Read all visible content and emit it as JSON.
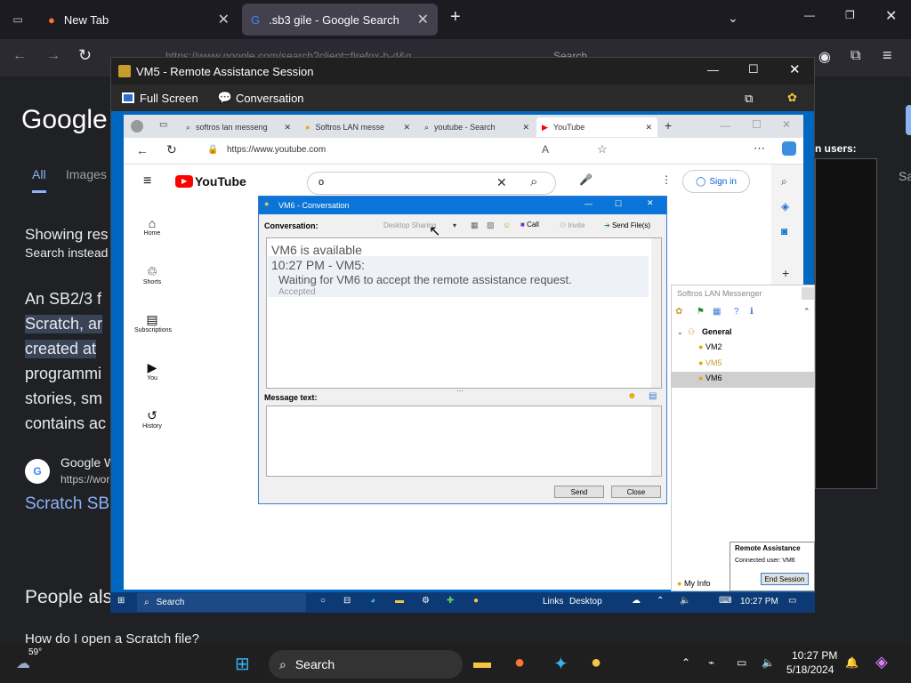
{
  "firefox": {
    "tabs": [
      {
        "label": "New Tab"
      },
      {
        "label": ".sb3 gile - Google Search"
      }
    ],
    "url_partial": "https://www.google.com/search?client=firefox-b-d&q",
    "search_placeholder": "Search"
  },
  "google": {
    "logo": "Google",
    "tabs": [
      "All",
      "Images"
    ],
    "showing": "Showing res",
    "search_instead": "Search instead",
    "para": [
      "An SB2/3 f",
      "Scratch, ar",
      "created at",
      "programmi",
      "stories, sm",
      "contains ac"
    ],
    "result_site": "Google W",
    "result_url": "https://wor",
    "result_title": "Scratch SB",
    "people_also": "People als",
    "faq": "How do I open a Scratch file?",
    "right_users": "n users:",
    "right_sa": "Sa"
  },
  "ra": {
    "title": "VM5 - Remote Assistance Session",
    "full_screen": "Full Screen",
    "conversation": "Conversation"
  },
  "edge": {
    "tabs": [
      "softros lan messeng",
      "Softros LAN messe",
      "youtube - Search",
      "YouTube"
    ],
    "url": "https://www.youtube.com"
  },
  "youtube": {
    "brand": "YouTube",
    "search_value": "o",
    "sign_in": "Sign in",
    "nav": [
      "Home",
      "Shorts",
      "Subscriptions",
      "You",
      "History"
    ]
  },
  "conv": {
    "title": "VM6 - Conversation",
    "conversation_label": "Conversation:",
    "desktop_sharing": "Desktop Sharing",
    "call": "Call",
    "invite": "Invite",
    "send_files": "Send File(s)",
    "log": [
      "VM6 is available",
      "10:27 PM - VM5:",
      "Waiting for VM6 to accept the remote assistance request.",
      "Accepted"
    ],
    "message_label": "Message text:",
    "send": "Send",
    "close": "Close"
  },
  "lan": {
    "title": "Softros LAN Messenger",
    "group": "General",
    "users": [
      "VM2",
      "VM5",
      "VM6"
    ],
    "my_info": "My Info"
  },
  "ra_box": {
    "title": "Remote Assistance",
    "connected": "Connected user: VM6",
    "end": "End Session"
  },
  "remote_taskbar": {
    "search": "Search",
    "links": "Links",
    "desktop": "Desktop",
    "time": "10:27 PM"
  },
  "taskbar": {
    "weather": "59°",
    "search": "Search",
    "time": "10:27 PM",
    "date": "5/18/2024"
  },
  "colors": {
    "accent": "#0067c0",
    "yt_red": "#ff0000",
    "conv_title": "#0a74d8"
  }
}
